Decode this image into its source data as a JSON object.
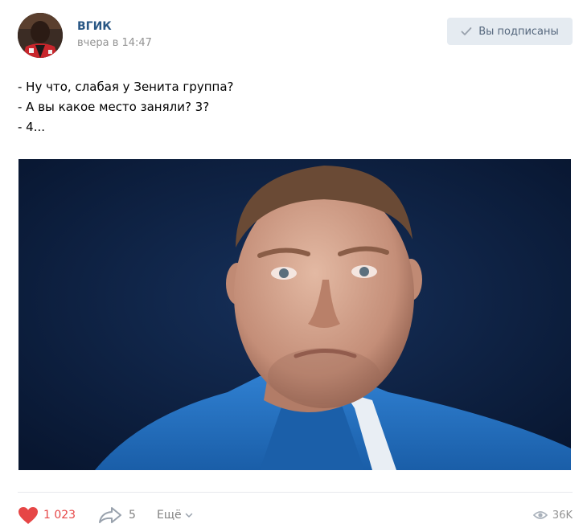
{
  "post": {
    "author": "ВГИК",
    "time": "вчера в 14:47",
    "subscribe_label": "Вы подписаны",
    "text_lines": [
      "- Ну что, слабая у Зенита группа?",
      "- А вы какое место заняли? 3?",
      "- 4..."
    ]
  },
  "actions": {
    "likes": "1 023",
    "shares": "5",
    "more_label": "Ещё",
    "views": "36K"
  },
  "icons": {
    "subscribe": "check-icon",
    "like": "heart-icon",
    "share": "share-arrow-icon",
    "more": "chevron-down-icon",
    "views": "eye-icon"
  },
  "colors": {
    "author": "#2a5885",
    "like_active": "#e64646",
    "button_bg": "#e5ebf1",
    "button_text": "#55677d",
    "muted": "#828282"
  }
}
